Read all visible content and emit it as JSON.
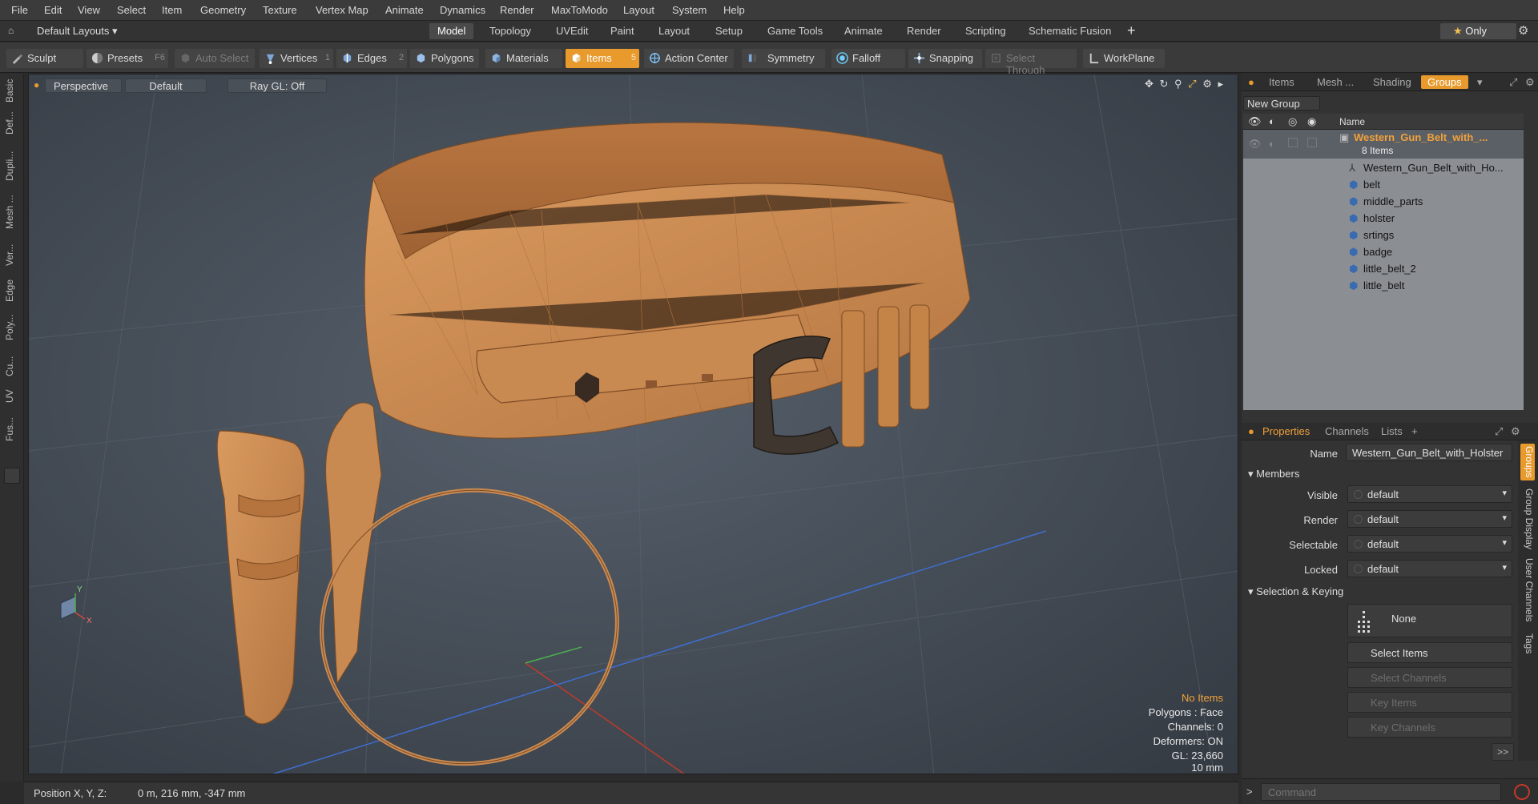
{
  "menubar": {
    "items": [
      "File",
      "Edit",
      "View",
      "Select",
      "Item",
      "Geometry",
      "Texture",
      "Vertex Map",
      "Animate",
      "Dynamics",
      "Render",
      "MaxToModo",
      "Layout",
      "System",
      "Help"
    ]
  },
  "layoutbar": {
    "layout_selector": "Default Layouts",
    "tabs": [
      "Model",
      "Topology",
      "UVEdit",
      "Paint",
      "Layout",
      "Setup",
      "Game Tools",
      "Animate",
      "Render",
      "Scripting",
      "Schematic Fusion"
    ],
    "active_tab": "Model",
    "only_label": "Only"
  },
  "toolbar": {
    "sculpt": "Sculpt",
    "presets": "Presets",
    "presets_key": "F6",
    "auto_select": "Auto Select",
    "vertices": "Vertices",
    "vertices_key": "1",
    "edges": "Edges",
    "edges_key": "2",
    "polygons": "Polygons",
    "materials": "Materials",
    "items": "Items",
    "items_key": "5",
    "action_center": "Action Center",
    "symmetry": "Symmetry",
    "falloff": "Falloff",
    "snapping": "Snapping",
    "select_through": "Select Through",
    "workplane": "WorkPlane"
  },
  "left_tabs": [
    "Basic",
    "Def...",
    "Dupli...",
    "Mesh ...",
    "Ver...",
    "Edge",
    "Poly...",
    "Cu...",
    "UV",
    "Fus..."
  ],
  "viewport": {
    "view_mode": "Perspective",
    "shading": "Default",
    "raygl": "Ray GL: Off",
    "stats": {
      "selection": "No Items",
      "polygons": "Polygons : Face",
      "channels": "Channels: 0",
      "deformers": "Deformers: ON",
      "gl": "GL: 23,660",
      "scale": "10 mm"
    },
    "axis_x": "X",
    "axis_y": "Y",
    "colors": {
      "background": "#424a55",
      "leather": "#c98a52",
      "buckle": "#3e362f",
      "accent": "#e89a2c"
    }
  },
  "statusbar": {
    "position_label": "Position X, Y, Z:",
    "position_value": "0 m, 216 mm, -347 mm"
  },
  "items_panel": {
    "tabs": [
      "Items",
      "Mesh ...",
      "Shading",
      "Groups"
    ],
    "active_tab": "Groups",
    "new_group": "New Group",
    "column_name": "Name",
    "group_name": "Western_Gun_Belt_with_...",
    "group_count": "8 Items",
    "children": [
      {
        "name": "Western_Gun_Belt_with_Ho...",
        "icon": "locator-icon"
      },
      {
        "name": "belt",
        "icon": "mesh-icon"
      },
      {
        "name": "middle_parts",
        "icon": "mesh-icon"
      },
      {
        "name": "holster",
        "icon": "mesh-icon"
      },
      {
        "name": "srtings",
        "icon": "mesh-icon"
      },
      {
        "name": "badge",
        "icon": "mesh-icon"
      },
      {
        "name": "little_belt_2",
        "icon": "mesh-icon"
      },
      {
        "name": "little_belt",
        "icon": "mesh-icon"
      }
    ]
  },
  "properties_panel": {
    "tabs": [
      "Properties",
      "Channels",
      "Lists"
    ],
    "active_tab": "Properties",
    "name_label": "Name",
    "name_value": "Western_Gun_Belt_with_Holster",
    "members_header": "Members",
    "rows": [
      {
        "label": "Visible",
        "value": "default"
      },
      {
        "label": "Render",
        "value": "default"
      },
      {
        "label": "Selectable",
        "value": "default"
      },
      {
        "label": "Locked",
        "value": "default"
      }
    ],
    "selection_header": "Selection & Keying",
    "none_label": "None",
    "select_items": "Select Items",
    "select_channels": "Select Channels",
    "key_items": "Key Items",
    "key_channels": "Key Channels",
    "more": ">>",
    "side_tabs": [
      "Groups",
      "Group Display",
      "User Channels",
      "Tags"
    ]
  },
  "command": {
    "placeholder": "Command",
    "prompt": ">"
  }
}
